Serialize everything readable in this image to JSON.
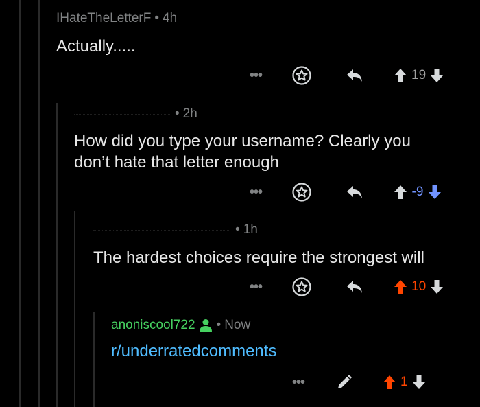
{
  "colors": {
    "background": "#000000",
    "meta_gray": "#818384",
    "body_text": "#e8e8e8",
    "upvote_orange": "#ff4500",
    "downvote_blue": "#7193ff",
    "link_blue": "#4fbcff",
    "op_green": "#46d160"
  },
  "comments": [
    {
      "username": "IHateTheLetterF",
      "separator": "•",
      "time": "4h",
      "body": "Actually.....",
      "more_label": "•••",
      "score": "19",
      "vote_state": "none"
    },
    {
      "username": "",
      "separator": "•",
      "time": "2h",
      "body_line1": "How did you type your username? Clearly you",
      "body_line2": "don’t hate that letter enough",
      "more_label": "•••",
      "score": "-9",
      "vote_state": "downvoted"
    },
    {
      "username": "",
      "separator": "•",
      "time": "1h",
      "body": "The hardest choices require the strongest will",
      "more_label": "•••",
      "score": "10",
      "vote_state": "upvoted"
    },
    {
      "username": "anoniscool722",
      "separator": "•",
      "time": "Now",
      "body": "r/underratedcomments",
      "more_label": "•••",
      "score": "1",
      "vote_state": "upvoted"
    }
  ],
  "icons": {
    "more": "more-options-icon",
    "save": "star-award-icon",
    "reply": "reply-arrow-icon",
    "upvote": "upvote-arrow-icon",
    "downvote": "downvote-arrow-icon",
    "edit": "pencil-edit-icon",
    "user": "person-icon"
  }
}
